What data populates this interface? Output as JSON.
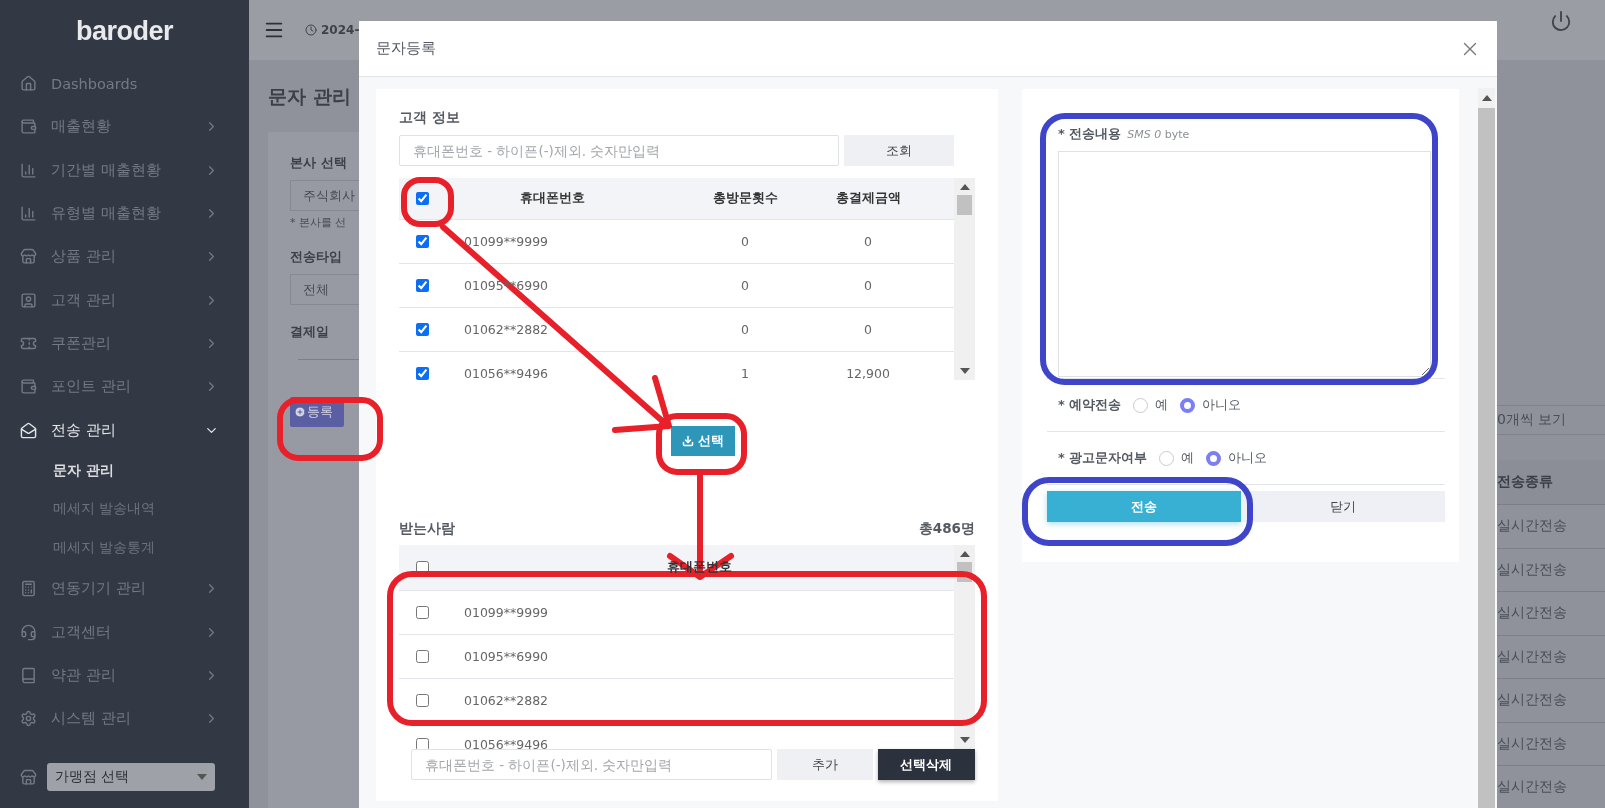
{
  "sidebar": {
    "logo": "baroder",
    "items": [
      {
        "label": "Dashboards"
      },
      {
        "label": "매출현황",
        "expanded": false
      },
      {
        "label": "기간별 매출현황",
        "expanded": false
      },
      {
        "label": "유형별 매출현황",
        "expanded": false
      },
      {
        "label": "상품 관리",
        "expanded": false
      },
      {
        "label": "고객 관리",
        "expanded": false
      },
      {
        "label": "쿠폰관리",
        "expanded": false
      },
      {
        "label": "포인트 관리",
        "expanded": false
      },
      {
        "label": "전송 관리",
        "expanded": true,
        "children": [
          {
            "label": "문자 관리",
            "selected": true
          },
          {
            "label": "메세지 발송내역",
            "selected": false
          },
          {
            "label": "메세지 발송통계",
            "selected": false
          }
        ]
      },
      {
        "label": "연동기기 관리",
        "expanded": false
      },
      {
        "label": "고객센터",
        "expanded": false
      },
      {
        "label": "약관 관리",
        "expanded": false
      },
      {
        "label": "시스템 관리",
        "expanded": false
      }
    ],
    "store_select": {
      "value": "가맹점 선택"
    }
  },
  "topbar": {
    "date": "2024-"
  },
  "page": {
    "title": "문자 관리",
    "filters": [
      {
        "label": "본사 선택",
        "value": "주식회사",
        "note": "* 본사를 선"
      },
      {
        "label": "전송타입",
        "value": "전체"
      },
      {
        "label": "결제일"
      }
    ],
    "register_button": "등록",
    "page_size": "0개씩 보기",
    "column_header": "전송종류",
    "cells": [
      "실시간전송",
      "실시간전송",
      "실시간전송",
      "실시간전송",
      "실시간전송",
      "실시간전송",
      "실시간전송"
    ]
  },
  "modal": {
    "title": "문자등록",
    "customer_info": {
      "title": "고객 정보",
      "search": {
        "placeholder": "휴대폰번호 - 하이픈(-)제외. 숫자만입력"
      },
      "search_button": "조회",
      "columns": [
        "휴대폰번호",
        "총방문횟수",
        "총결제금액"
      ],
      "all_checked": true,
      "rows": [
        {
          "phone": "01099**9999",
          "visits": "0",
          "amount": "0",
          "checked": true
        },
        {
          "phone": "01095**6990",
          "visits": "0",
          "amount": "0",
          "checked": true
        },
        {
          "phone": "01062**2882",
          "visits": "0",
          "amount": "0",
          "checked": true
        },
        {
          "phone": "01056**9496",
          "visits": "1",
          "amount": "12,900",
          "checked": true
        }
      ]
    },
    "select_button": "선택",
    "recipients": {
      "title": "받는사람",
      "total": "총486명",
      "column": "휴대폰번호",
      "all_checked": false,
      "rows": [
        {
          "phone": "01099**9999",
          "checked": false
        },
        {
          "phone": "01095**6990",
          "checked": false
        },
        {
          "phone": "01062**2882",
          "checked": false
        },
        {
          "phone": "01056**9496",
          "checked": false
        }
      ],
      "input": {
        "placeholder": "휴대폰번호 - 하이픈(-)제외. 숫자만입력"
      },
      "add_button": "추가",
      "delete_button": "선택삭제"
    },
    "message": {
      "label": "* 전송내용",
      "byte_info": "*SMS 0* byte",
      "options": [
        {
          "label": "* 예약전송",
          "choices": [
            {
              "label": "예",
              "selected": false
            },
            {
              "label": "아니오",
              "selected": true
            }
          ]
        },
        {
          "label": "* 광고문자여부",
          "choices": [
            {
              "label": "예",
              "selected": false
            },
            {
              "label": "아니오",
              "selected": true
            }
          ]
        }
      ],
      "send_button": "전송",
      "close_button": "닫기"
    }
  }
}
